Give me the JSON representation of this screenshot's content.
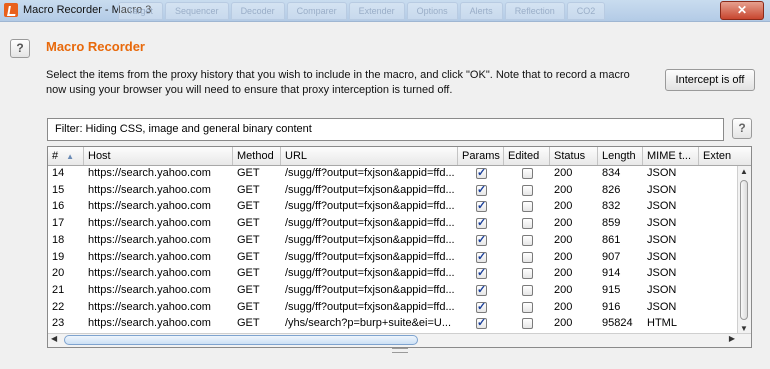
{
  "window": {
    "title": "Macro Recorder - Macro 3",
    "close_glyph": "✕",
    "background_tabs": [
      "Target",
      "Sequencer",
      "Decoder",
      "Comparer",
      "Extender",
      "Options",
      "Alerts",
      "Reflection",
      "CO2"
    ]
  },
  "header": {
    "help_glyph": "?",
    "title": "Macro Recorder",
    "instructions": "Select the items from the proxy history that you wish to include in the macro, and click \"OK\". Note that to record a macro now using your browser you will need to ensure that proxy interception is turned off.",
    "intercept_button": "Intercept is off"
  },
  "filter": {
    "text": "Filter: Hiding CSS, image and general binary content",
    "help_glyph": "?"
  },
  "table": {
    "columns": [
      "#",
      "Host",
      "Method",
      "URL",
      "Params",
      "Edited",
      "Status",
      "Length",
      "MIME t...",
      "Exten"
    ],
    "sort_icon": "▲",
    "rows": [
      {
        "num": "14",
        "host": "https://search.yahoo.com",
        "method": "GET",
        "url": "/sugg/ff?output=fxjson&appid=ffd...",
        "params": true,
        "edited": false,
        "status": "200",
        "length": "834",
        "mime": "JSON",
        "ext": ""
      },
      {
        "num": "15",
        "host": "https://search.yahoo.com",
        "method": "GET",
        "url": "/sugg/ff?output=fxjson&appid=ffd...",
        "params": true,
        "edited": false,
        "status": "200",
        "length": "826",
        "mime": "JSON",
        "ext": ""
      },
      {
        "num": "16",
        "host": "https://search.yahoo.com",
        "method": "GET",
        "url": "/sugg/ff?output=fxjson&appid=ffd...",
        "params": true,
        "edited": false,
        "status": "200",
        "length": "832",
        "mime": "JSON",
        "ext": ""
      },
      {
        "num": "17",
        "host": "https://search.yahoo.com",
        "method": "GET",
        "url": "/sugg/ff?output=fxjson&appid=ffd...",
        "params": true,
        "edited": false,
        "status": "200",
        "length": "859",
        "mime": "JSON",
        "ext": ""
      },
      {
        "num": "18",
        "host": "https://search.yahoo.com",
        "method": "GET",
        "url": "/sugg/ff?output=fxjson&appid=ffd...",
        "params": true,
        "edited": false,
        "status": "200",
        "length": "861",
        "mime": "JSON",
        "ext": ""
      },
      {
        "num": "19",
        "host": "https://search.yahoo.com",
        "method": "GET",
        "url": "/sugg/ff?output=fxjson&appid=ffd...",
        "params": true,
        "edited": false,
        "status": "200",
        "length": "907",
        "mime": "JSON",
        "ext": ""
      },
      {
        "num": "20",
        "host": "https://search.yahoo.com",
        "method": "GET",
        "url": "/sugg/ff?output=fxjson&appid=ffd...",
        "params": true,
        "edited": false,
        "status": "200",
        "length": "914",
        "mime": "JSON",
        "ext": ""
      },
      {
        "num": "21",
        "host": "https://search.yahoo.com",
        "method": "GET",
        "url": "/sugg/ff?output=fxjson&appid=ffd...",
        "params": true,
        "edited": false,
        "status": "200",
        "length": "915",
        "mime": "JSON",
        "ext": ""
      },
      {
        "num": "22",
        "host": "https://search.yahoo.com",
        "method": "GET",
        "url": "/sugg/ff?output=fxjson&appid=ffd...",
        "params": true,
        "edited": false,
        "status": "200",
        "length": "916",
        "mime": "JSON",
        "ext": ""
      },
      {
        "num": "23",
        "host": "https://search.yahoo.com",
        "method": "GET",
        "url": "/yhs/search?p=burp+suite&ei=U...",
        "params": true,
        "edited": false,
        "status": "200",
        "length": "95824",
        "mime": "HTML",
        "ext": ""
      }
    ]
  },
  "colors": {
    "heading": "#e8690b",
    "close_button": "#c8462f",
    "checkmark": "#1a3f9a"
  }
}
